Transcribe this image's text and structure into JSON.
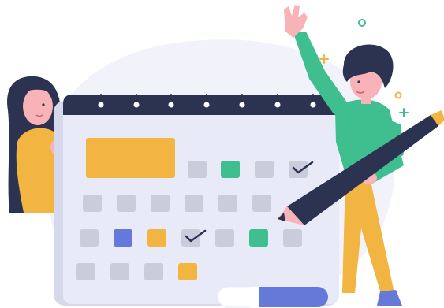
{
  "illustration": {
    "subject": "calendar-scheduling",
    "colors": {
      "navy": "#2B3350",
      "calendar_face": "#E8EAF7",
      "calendar_edge": "#D6D9EE",
      "cell_gray": "#C9CCDA",
      "orange": "#F2B541",
      "green": "#3FBF8F",
      "blue": "#6479D9",
      "skin": "#F7B3B7",
      "shirt_green": "#3FBF8F",
      "pants_yellow": "#F2B541",
      "blob": "#F2F3FA"
    },
    "icons": [
      "checkmark-icon",
      "sparkle-icon",
      "circle-icon",
      "pencil-icon"
    ]
  }
}
